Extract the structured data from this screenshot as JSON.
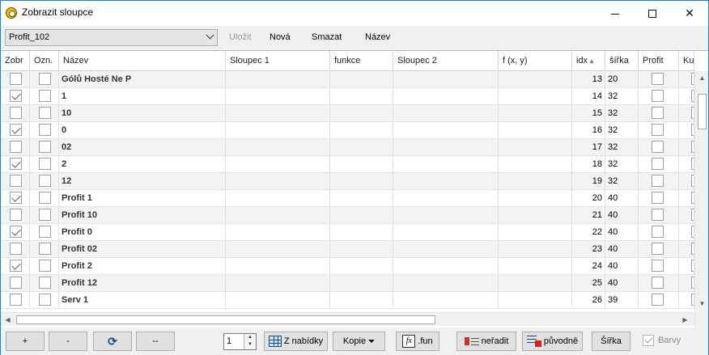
{
  "window": {
    "title": "Zobrazit sloupce"
  },
  "toolbar": {
    "profile_value": "Profit_102",
    "save_label": "Uložit",
    "new_label": "Nová",
    "delete_label": "Smazat",
    "name_label": "Název"
  },
  "grid": {
    "headers": {
      "show": "Zobr",
      "mark": "Ozn.",
      "name": "Název",
      "col1": "Sloupec 1",
      "func": "funkce",
      "col2": "Sloupec 2",
      "fxy": "f (x, y)",
      "idx": "idx",
      "width": "šířka",
      "profit": "Profit",
      "extra": "Ku"
    },
    "rows": [
      {
        "show": false,
        "mark": false,
        "name": "Gólů Hosté Ne P",
        "idx": "13",
        "width": "20",
        "profit": false
      },
      {
        "show": true,
        "mark": false,
        "name": "1",
        "idx": "14",
        "width": "32",
        "profit": false
      },
      {
        "show": false,
        "mark": false,
        "name": "10",
        "idx": "15",
        "width": "32",
        "profit": false
      },
      {
        "show": true,
        "mark": false,
        "name": "0",
        "idx": "16",
        "width": "32",
        "profit": false
      },
      {
        "show": false,
        "mark": false,
        "name": "02",
        "idx": "17",
        "width": "32",
        "profit": false
      },
      {
        "show": true,
        "mark": false,
        "name": "2",
        "idx": "18",
        "width": "32",
        "profit": false
      },
      {
        "show": false,
        "mark": false,
        "name": "12",
        "idx": "19",
        "width": "32",
        "profit": false
      },
      {
        "show": true,
        "mark": false,
        "name": "Profit 1",
        "idx": "20",
        "width": "40",
        "profit": false
      },
      {
        "show": false,
        "mark": false,
        "name": "Profit 10",
        "idx": "21",
        "width": "40",
        "profit": false
      },
      {
        "show": true,
        "mark": false,
        "name": "Profit 0",
        "idx": "22",
        "width": "40",
        "profit": false
      },
      {
        "show": false,
        "mark": false,
        "name": "Profit 02",
        "idx": "23",
        "width": "40",
        "profit": false
      },
      {
        "show": true,
        "mark": false,
        "name": "Profit 2",
        "idx": "24",
        "width": "40",
        "profit": false
      },
      {
        "show": false,
        "mark": false,
        "name": "Profit 12",
        "idx": "25",
        "width": "40",
        "profit": false
      },
      {
        "show": false,
        "mark": false,
        "name": "Serv 1",
        "idx": "26",
        "width": "39",
        "profit": false
      }
    ]
  },
  "bottom": {
    "add_label": "+",
    "remove_label": "-",
    "dash_label": "--",
    "spin_value": "1",
    "from_offer_label": "Z nabídky",
    "copy_label": "Kopie",
    "fun_label": ".fun",
    "nosort_label": "neřadit",
    "original_label": "původně",
    "width_label": "Šířka",
    "colors_label": "Barvy"
  }
}
